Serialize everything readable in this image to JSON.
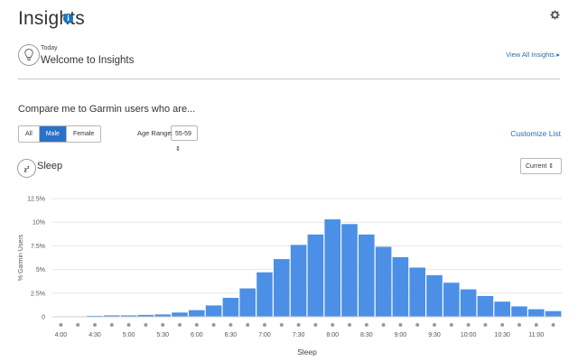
{
  "header": {
    "title": "Insights",
    "info_icon": "info-icon",
    "settings_icon": "gear-icon"
  },
  "card": {
    "icon": "lightbulb-icon",
    "eyebrow": "Today",
    "title": "Welcome to Insights",
    "link": "View All Insights ▸"
  },
  "compare": {
    "heading": "Compare me to Garmin users who are...",
    "segments": [
      "All",
      "Male",
      "Female"
    ],
    "selected_segment": "Male",
    "age_label": "Age Range:",
    "age_value": "55-59 ⇕",
    "customize": "Customize List"
  },
  "sleep": {
    "icon": "zzz-icon",
    "title": "Sleep",
    "current_select": "Current ⇕"
  },
  "colors": {
    "accent": "#2a72c8",
    "bar": "#4b90e6",
    "link": "#2a6db0"
  },
  "chart_data": {
    "type": "bar",
    "xlabel": "Sleep",
    "ylabel": "% Garmin Users",
    "ylim": [
      0,
      12.5
    ],
    "yticks": [
      "0",
      "2.5%",
      "5%",
      "7.5%",
      "10%",
      "12.5%"
    ],
    "grid": true,
    "x_tick_labels": [
      "4:00",
      "4:30",
      "5:00",
      "5:30",
      "6:00",
      "6:30",
      "7:00",
      "7:30",
      "8:00",
      "8:30",
      "9:00",
      "9:30",
      "10:00",
      "10:30",
      "11:00"
    ],
    "categories": [
      "4:00",
      "4:15",
      "4:30",
      "4:45",
      "5:00",
      "5:15",
      "5:30",
      "5:45",
      "6:00",
      "6:15",
      "6:30",
      "6:45",
      "7:00",
      "7:15",
      "7:30",
      "7:45",
      "8:00",
      "8:15",
      "8:30",
      "8:45",
      "9:00",
      "9:15",
      "9:30",
      "9:45",
      "10:00",
      "10:15",
      "10:30",
      "10:45",
      "11:00",
      "11:15"
    ],
    "values": [
      0.02,
      0.05,
      0.1,
      0.15,
      0.15,
      0.2,
      0.25,
      0.45,
      0.7,
      1.2,
      2.0,
      3.0,
      4.7,
      6.1,
      7.6,
      8.7,
      10.3,
      9.8,
      8.7,
      7.4,
      6.3,
      5.2,
      4.4,
      3.6,
      2.9,
      2.2,
      1.6,
      1.1,
      0.8,
      0.6
    ]
  }
}
